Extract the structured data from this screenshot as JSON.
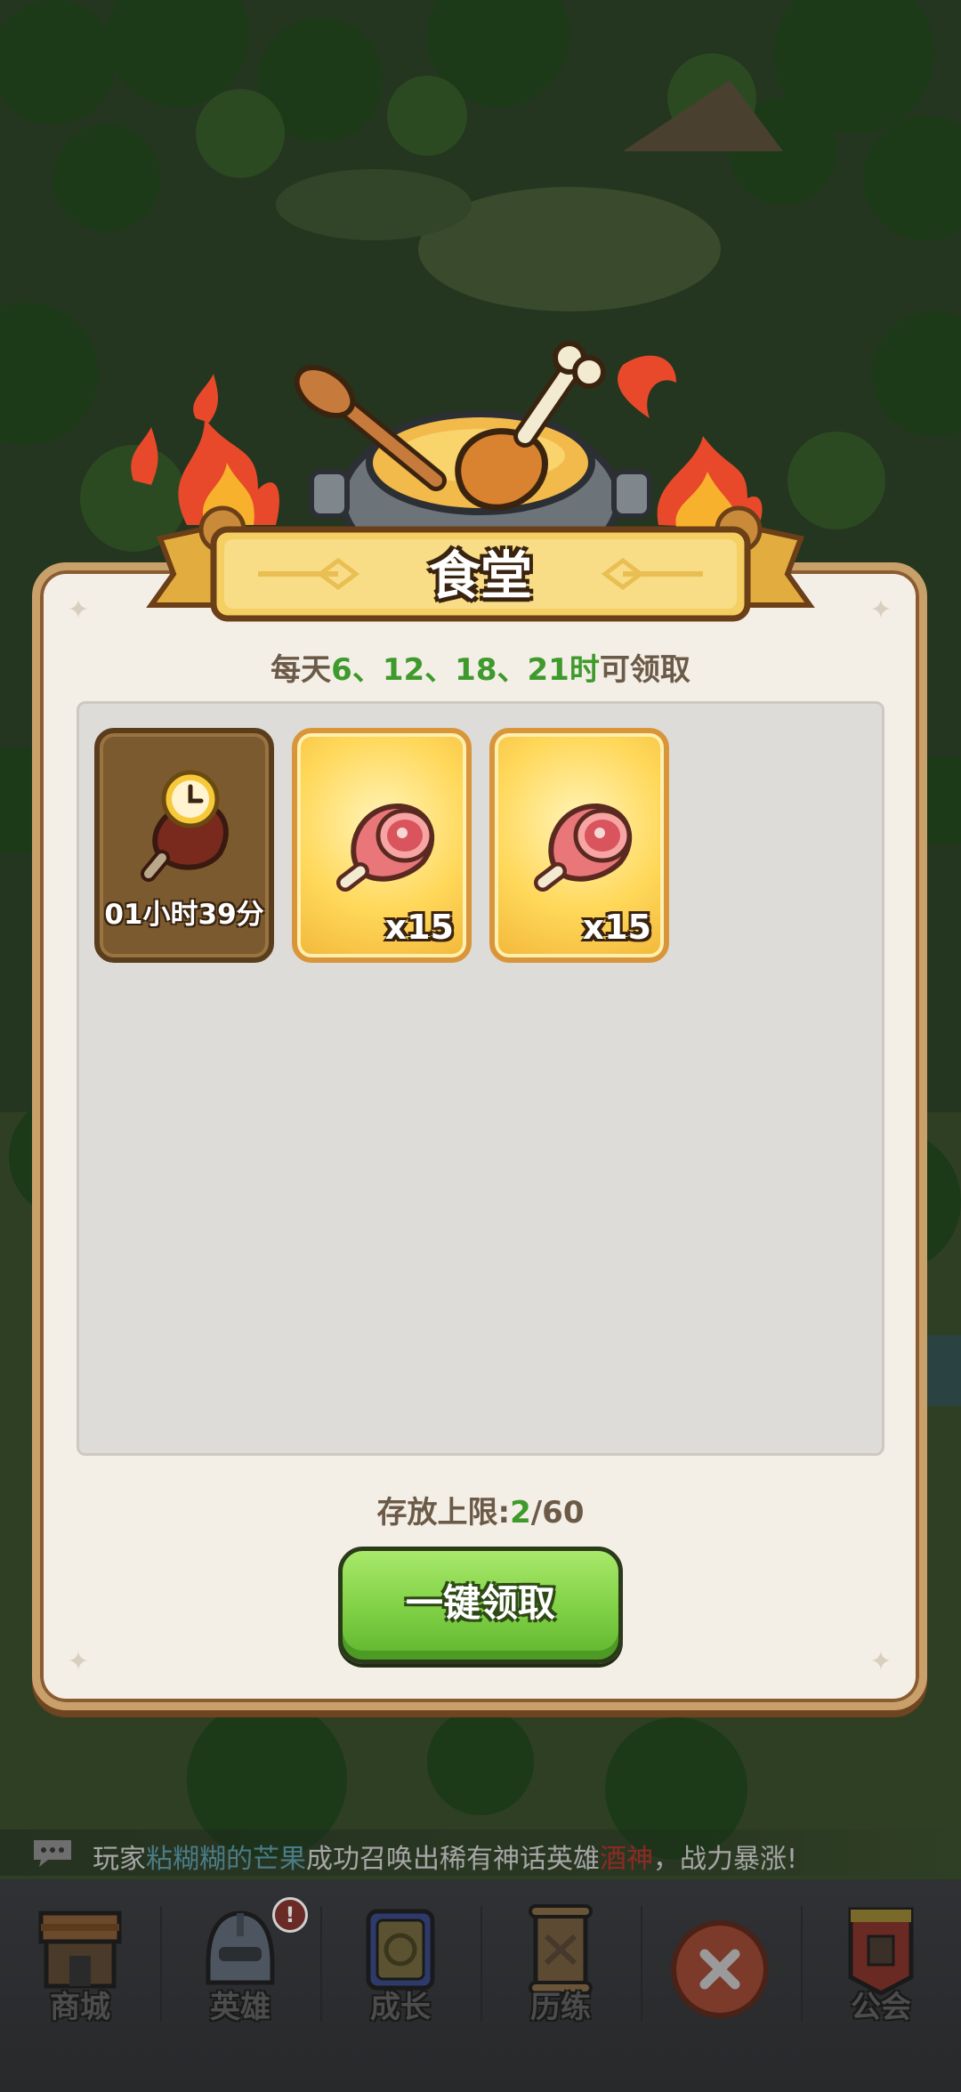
{
  "dialog": {
    "title": "食堂",
    "schedule": {
      "prefix": "每天",
      "hours": [
        "6",
        "12",
        "18",
        "21"
      ],
      "separator": "、",
      "hour_suffix": "时",
      "suffix": "可领取"
    },
    "items": [
      {
        "type": "timer",
        "label": "01小时39分",
        "icon": "meat-clock-icon"
      },
      {
        "type": "meat",
        "quantity": "x15",
        "icon": "meat-icon"
      },
      {
        "type": "meat",
        "quantity": "x15",
        "icon": "meat-icon"
      }
    ],
    "storage": {
      "label": "存放上限:",
      "current": "2",
      "max": "/60"
    },
    "claim_button": "一键领取"
  },
  "ticker": {
    "prefix": "玩家",
    "player": "粘糊糊的芒果",
    "middle": "成功召唤出稀有神话英雄",
    "hero": "酒神",
    "suffix": "，战力暴涨!"
  },
  "bottom_nav": {
    "items": [
      {
        "label": "商城",
        "icon": "shop-icon"
      },
      {
        "label": "英雄",
        "icon": "hero-helmet-icon",
        "badge": "!"
      },
      {
        "label": "成长",
        "icon": "growth-scroll-icon"
      },
      {
        "label": "历练",
        "icon": "map-icon"
      },
      {
        "label": "",
        "icon": "close-icon"
      },
      {
        "label": "公会",
        "icon": "guild-banner-icon"
      }
    ]
  },
  "colors": {
    "accent_green": "#3e9a2c",
    "button_green": "#7fd045",
    "panel_border": "#c9a06a",
    "banner_gold": "#f6cf63"
  }
}
